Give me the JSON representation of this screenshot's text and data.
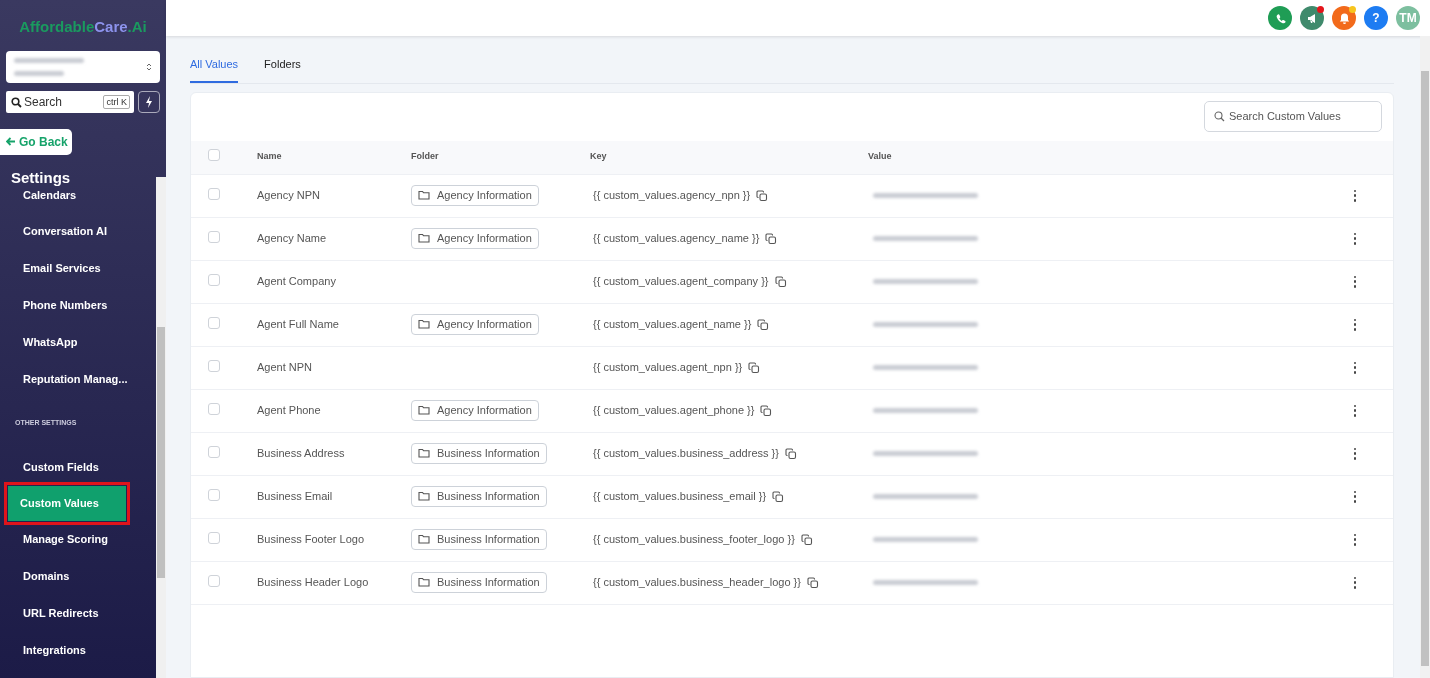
{
  "sidebar": {
    "logo": {
      "part_1": "Affordable",
      "part_2": "Care",
      "part_3": ".Ai"
    },
    "search": {
      "placeholder": "Search",
      "shortcut": "ctrl K"
    },
    "go_back": "Go Back",
    "heading": "Settings",
    "items": [
      {
        "kind": "link",
        "label": "Calendars",
        "selected": false
      },
      {
        "kind": "link",
        "label": "Conversation AI",
        "selected": false
      },
      {
        "kind": "link",
        "label": "Email Services",
        "selected": false
      },
      {
        "kind": "link",
        "label": "Phone Numbers",
        "selected": false
      },
      {
        "kind": "link",
        "label": "WhatsApp",
        "selected": false
      },
      {
        "kind": "link",
        "label": "Reputation Manag...",
        "selected": false
      },
      {
        "kind": "section",
        "label": "OTHER SETTINGS"
      },
      {
        "kind": "link",
        "label": "Custom Fields",
        "selected": false
      },
      {
        "kind": "link",
        "label": "Custom Values",
        "selected": true,
        "annotated": true
      },
      {
        "kind": "link",
        "label": "Manage Scoring",
        "selected": false
      },
      {
        "kind": "link",
        "label": "Domains",
        "selected": false
      },
      {
        "kind": "link",
        "label": "URL Redirects",
        "selected": false
      },
      {
        "kind": "link",
        "label": "Integrations",
        "selected": false
      }
    ]
  },
  "header": {
    "actions": [
      {
        "kind": "phone",
        "color": "#1f9d55",
        "dot": false
      },
      {
        "kind": "megaphone",
        "color": "#3f8a6c",
        "dot": true
      },
      {
        "kind": "bell",
        "color": "#f26a1b",
        "dot": true
      },
      {
        "kind": "help",
        "color": "#1d7cf2",
        "dot": false,
        "text": "?"
      },
      {
        "kind": "avatar",
        "color": "#7dbf9f",
        "dot": false,
        "text": "TM"
      }
    ]
  },
  "tabs": [
    {
      "label": "All Values",
      "selected": true
    },
    {
      "label": "Folders",
      "selected": false
    }
  ],
  "table": {
    "search": {
      "placeholder": "Search Custom Values"
    },
    "all_checked": false,
    "columns": [
      "Name",
      "Folder",
      "Key",
      "Value"
    ],
    "rows": [
      {
        "name": "Agency NPN",
        "folder": "Agency Information",
        "key": "{{ custom_values.agency_npn }}",
        "checked": false
      },
      {
        "name": "Agency Name",
        "folder": "Agency Information",
        "key": "{{ custom_values.agency_name }}",
        "checked": false
      },
      {
        "name": "Agent Company",
        "key": "{{ custom_values.agent_company }}",
        "checked": false
      },
      {
        "name": "Agent Full Name",
        "folder": "Agency Information",
        "key": "{{ custom_values.agent_name }}",
        "checked": false
      },
      {
        "name": "Agent NPN",
        "key": "{{ custom_values.agent_npn }}",
        "checked": false
      },
      {
        "name": "Agent Phone",
        "folder": "Agency Information",
        "key": "{{ custom_values.agent_phone }}",
        "checked": false
      },
      {
        "name": "Business Address",
        "folder": "Business Information",
        "key": "{{ custom_values.business_address }}",
        "checked": false
      },
      {
        "name": "Business Email",
        "folder": "Business Information",
        "key": "{{ custom_values.business_email }}",
        "checked": false
      },
      {
        "name": "Business Footer Logo",
        "folder": "Business Information",
        "key": "{{ custom_values.business_footer_logo }}",
        "checked": false
      },
      {
        "name": "Business Header Logo",
        "folder": "Business Information",
        "key": "{{ custom_values.business_header_logo }}",
        "checked": false
      }
    ]
  }
}
